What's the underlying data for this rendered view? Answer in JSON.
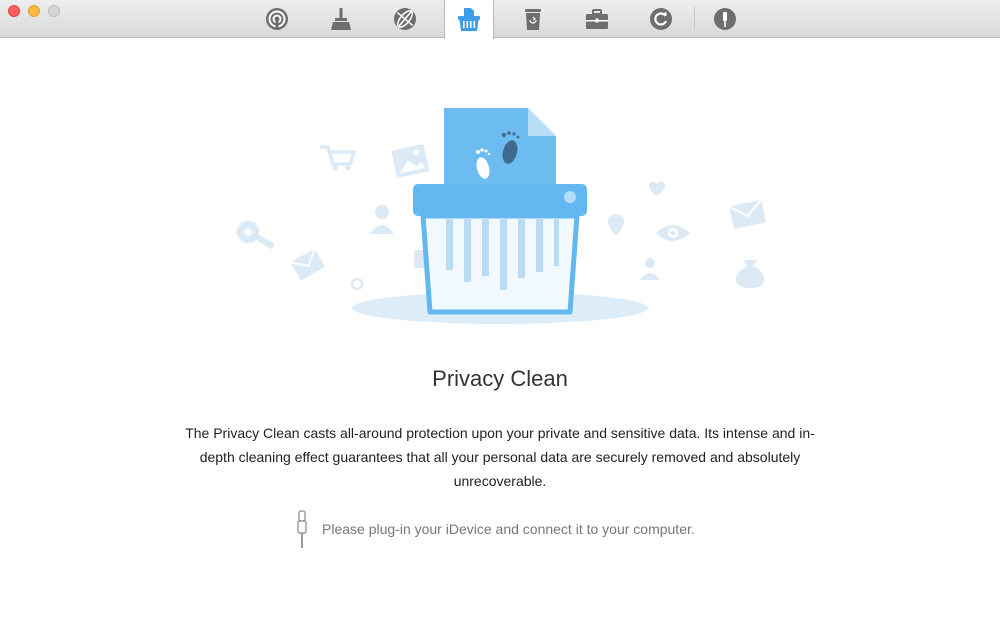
{
  "window": {
    "controls": [
      "close",
      "minimize",
      "zoom"
    ]
  },
  "toolbar": {
    "tabs": [
      {
        "icon": "airbackup-icon",
        "active": false
      },
      {
        "icon": "broom-icon",
        "active": false
      },
      {
        "icon": "globe-icon",
        "active": false
      },
      {
        "icon": "shredder-icon",
        "active": true
      },
      {
        "icon": "trash-icon",
        "active": false
      },
      {
        "icon": "toolbox-icon",
        "active": false
      },
      {
        "icon": "refresh-icon",
        "active": false
      },
      {
        "icon": "usb-icon",
        "active": false
      }
    ],
    "accent": "#4aa8e8"
  },
  "main": {
    "title": "Privacy Clean",
    "description": "The Privacy Clean casts all-around protection upon your private and sensitive data. Its intense and in-depth cleaning effect guarantees that all your personal data are securely removed and absolutely unrecoverable.",
    "hint": "Please plug-in your iDevice and connect it to your computer."
  }
}
